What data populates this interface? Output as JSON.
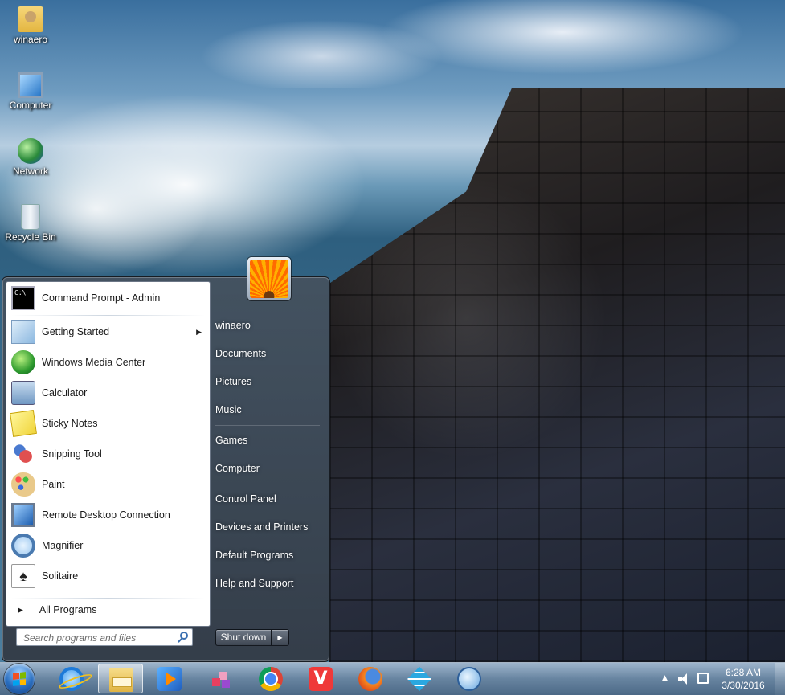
{
  "desktop": {
    "icons": [
      {
        "label": "winaero",
        "icon": "user-folder-icon"
      },
      {
        "label": "Computer",
        "icon": "computer-icon"
      },
      {
        "label": "Network",
        "icon": "network-icon"
      },
      {
        "label": "Recycle Bin",
        "icon": "recycle-bin-icon"
      }
    ]
  },
  "start_menu": {
    "pinned": [
      {
        "label": "Command Prompt - Admin",
        "icon": "command-prompt-icon"
      }
    ],
    "programs": [
      {
        "label": "Getting Started",
        "icon": "getting-started-icon",
        "has_submenu": true
      },
      {
        "label": "Windows Media Center",
        "icon": "media-center-icon"
      },
      {
        "label": "Calculator",
        "icon": "calculator-icon"
      },
      {
        "label": "Sticky Notes",
        "icon": "sticky-notes-icon"
      },
      {
        "label": "Snipping Tool",
        "icon": "snipping-tool-icon"
      },
      {
        "label": "Paint",
        "icon": "paint-icon"
      },
      {
        "label": "Remote Desktop Connection",
        "icon": "remote-desktop-icon"
      },
      {
        "label": "Magnifier",
        "icon": "magnifier-icon"
      },
      {
        "label": "Solitaire",
        "icon": "solitaire-icon"
      }
    ],
    "all_programs": "All Programs",
    "search": {
      "placeholder": "Search programs and files"
    },
    "right_pane": {
      "user": "winaero",
      "documents": "Documents",
      "pictures": "Pictures",
      "music": "Music",
      "games": "Games",
      "computer": "Computer",
      "control_panel": "Control Panel",
      "devices": "Devices and Printers",
      "default_programs": "Default Programs",
      "help": "Help and Support"
    },
    "shutdown": "Shut down"
  },
  "taskbar": {
    "pinned": [
      {
        "name": "internet-explorer-icon"
      },
      {
        "name": "file-explorer-icon",
        "active": true
      },
      {
        "name": "media-player-icon"
      },
      {
        "name": "cubes-app-icon"
      },
      {
        "name": "chrome-icon"
      },
      {
        "name": "vivaldi-icon"
      },
      {
        "name": "firefox-icon"
      },
      {
        "name": "grid-app-icon"
      },
      {
        "name": "search-app-icon"
      }
    ],
    "clock": {
      "time": "6:28 AM",
      "date": "3/30/2016"
    }
  }
}
